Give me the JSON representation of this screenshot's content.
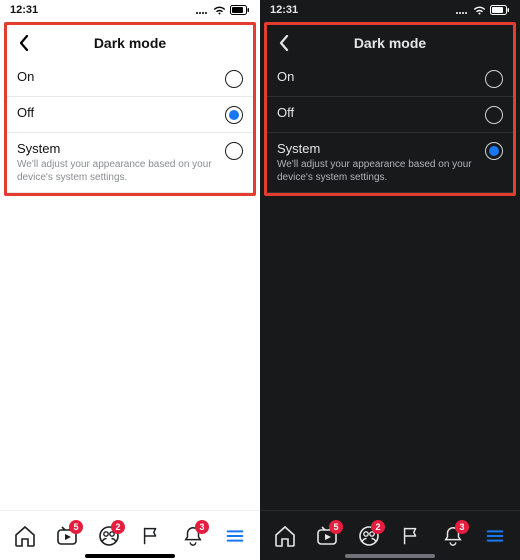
{
  "colors": {
    "highlight": "#e43c2f",
    "accent": "#1877f2",
    "badge": "#e41e3f"
  },
  "left": {
    "theme": "light",
    "status_time": "12:31",
    "title": "Dark mode",
    "options": [
      {
        "label": "On",
        "sub": "",
        "selected": false
      },
      {
        "label": "Off",
        "sub": "",
        "selected": true
      },
      {
        "label": "System",
        "sub": "We'll adjust your appearance based on your device's system settings.",
        "selected": false
      }
    ],
    "tabs": {
      "home_badge": "",
      "watch_badge": "5",
      "groups_badge": "2",
      "flag_badge": "",
      "notifications_badge": "3",
      "menu_active": true
    }
  },
  "right": {
    "theme": "dark",
    "status_time": "12:31",
    "title": "Dark mode",
    "options": [
      {
        "label": "On",
        "sub": "",
        "selected": false
      },
      {
        "label": "Off",
        "sub": "",
        "selected": false
      },
      {
        "label": "System",
        "sub": "We'll adjust your appearance based on your device's system settings.",
        "selected": true
      }
    ],
    "tabs": {
      "home_badge": "",
      "watch_badge": "5",
      "groups_badge": "2",
      "flag_badge": "",
      "notifications_badge": "3",
      "menu_active": true
    }
  }
}
